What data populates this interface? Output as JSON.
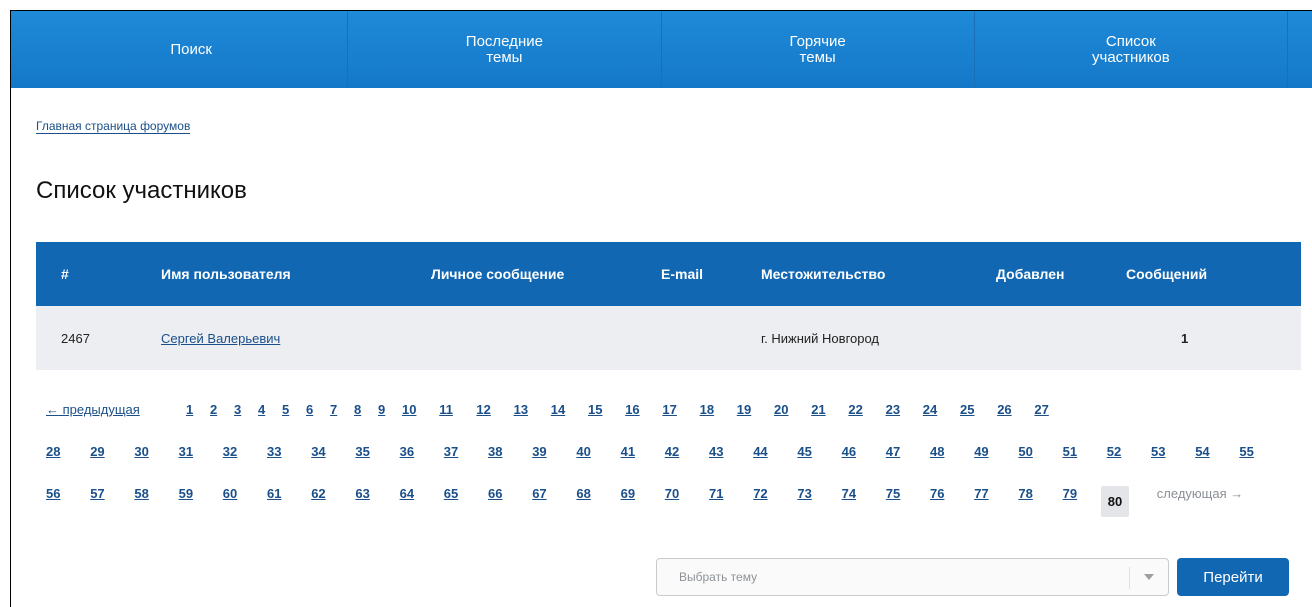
{
  "topnav": {
    "items": [
      {
        "label": "Поиск"
      },
      {
        "label": "Последние\nтемы"
      },
      {
        "label": "Горячие\nтемы"
      },
      {
        "label": "Список\nучастников"
      }
    ]
  },
  "breadcrumb": "Главная страница форумов",
  "page_title": "Список участников",
  "table": {
    "headers": [
      "#",
      "Имя пользователя",
      "Личное сообщение",
      "E-mail",
      "Местожительство",
      "Добавлен",
      "Сообщений"
    ],
    "rows": [
      {
        "num": "2467",
        "name": "Сергей Валерьевич",
        "pm": "",
        "email": "",
        "location": "г. Нижний Новгород",
        "added": "",
        "posts": "1"
      }
    ]
  },
  "pagination": {
    "prev": "← предыдущая",
    "next": "следующая →",
    "current": "80",
    "rows": [
      [
        "1",
        "2",
        "3",
        "4",
        "5",
        "6",
        "7",
        "8",
        "9",
        "10",
        "11",
        "12",
        "13",
        "14",
        "15",
        "16",
        "17",
        "18",
        "19",
        "20",
        "21",
        "22",
        "23",
        "24",
        "25",
        "26",
        "27"
      ],
      [
        "28",
        "29",
        "30",
        "31",
        "32",
        "33",
        "34",
        "35",
        "36",
        "37",
        "38",
        "39",
        "40",
        "41",
        "42",
        "43",
        "44",
        "45",
        "46",
        "47",
        "48",
        "49",
        "50",
        "51",
        "52",
        "53",
        "54",
        "55"
      ],
      [
        "56",
        "57",
        "58",
        "59",
        "60",
        "61",
        "62",
        "63",
        "64",
        "65",
        "66",
        "67",
        "68",
        "69",
        "70",
        "71",
        "72",
        "73",
        "74",
        "75",
        "76",
        "77",
        "78",
        "79"
      ]
    ]
  },
  "topic_select": {
    "placeholder": "Выбрать тему"
  },
  "go_button": "Перейти",
  "colors": {
    "nav_bg": "#1478c8",
    "header_bg": "#1267b3",
    "row_bg": "#eceef1",
    "link": "#1a4f8a"
  }
}
